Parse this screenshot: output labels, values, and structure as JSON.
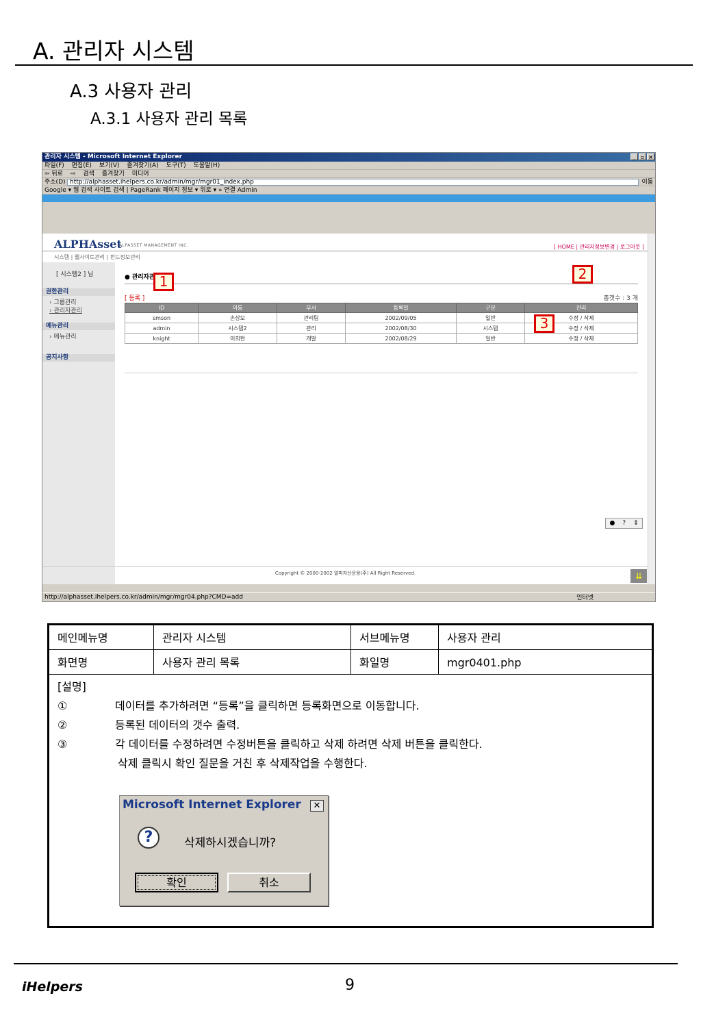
{
  "heading": {
    "h1": "A. 관리자 시스템",
    "h2": "A.3 사용자 관리",
    "h3": "A.3.1  사용자 관리 목록"
  },
  "browser": {
    "title": "관리자 시스템 - Microsoft Internet Explorer",
    "menu": [
      "파일(F)",
      "편집(E)",
      "보기(V)",
      "즐겨찾기(A)",
      "도구(T)",
      "도움말(H)"
    ],
    "toolbar": [
      "⇦ 뒤로",
      "⇨",
      "검색",
      "즐겨찾기",
      "미디어"
    ],
    "address_label": "주소(D)",
    "address": "http://alphasset.ihelpers.co.kr/admin/mgr/mgr01_index.php",
    "go_label": "이동",
    "google_bar": "Google ▾   웹 검색   사이트 검색  |  PageRank  페이지 정보 ▾  위로 ▾  »  연결   Admin",
    "status_url": "http://alphasset.ihelpers.co.kr/admin/mgr/mgr04.php?CMD=add",
    "status_zone": "인터넷"
  },
  "site": {
    "logo": "ALPHAsset",
    "logo_sub": "ALPASSET MANAGEMENT INC.",
    "top_links": "[ HOME  |  관리자정보변경  |  로그아웃 ]",
    "topnav": "시스템  |  웹사이트관리  |  펀드정보관리",
    "user": "[ 시스템2 ] 님",
    "sidebar": [
      {
        "head": "권한관리",
        "subs": [
          "› 그룹관리",
          "› 관리자관리"
        ]
      },
      {
        "head": "메뉴관리",
        "subs": [
          "› 메뉴관리"
        ]
      },
      {
        "head": "공지사항",
        "subs": []
      }
    ],
    "content_title": "● 관리자관리",
    "register": "[ 등록 ]",
    "total": "총갯수 : 3 개",
    "columns": [
      "ID",
      "이름",
      "부서",
      "등록일",
      "구분",
      "관리"
    ],
    "rows": [
      [
        "smson",
        "손상모",
        "관리팀",
        "2002/09/05",
        "일반",
        "수정 / 삭제"
      ],
      [
        "admin",
        "시스템2",
        "관리",
        "2002/08/30",
        "시스템",
        "수정 / 삭제"
      ],
      [
        "knight",
        "이희현",
        "개발",
        "2002/08/29",
        "일반",
        "수정 / 삭제"
      ]
    ],
    "copyright": "Copyright © 2000-2002 알파자산운용(주) All Right Reserved."
  },
  "callouts": [
    "1",
    "2",
    "3"
  ],
  "spec": {
    "main_menu_label": "메인메뉴명",
    "main_menu_value": "관리자 시스템",
    "sub_menu_label": "서브메뉴명",
    "sub_menu_value": "사용자 관리",
    "screen_label": "화면명",
    "screen_value": "사용자 관리 목록",
    "file_label": "화일명",
    "file_value": "mgr0401.php",
    "desc_title": "[설명]",
    "items": [
      {
        "num": "①",
        "text": "데이터를 추가하려면 “등록”을 클릭하면 등록화면으로 이동합니다."
      },
      {
        "num": "②",
        "text": "등록된 데이터의 갯수 출력."
      },
      {
        "num": "③",
        "text": "각 데이터를 수정하려면 수정버튼을 클릭하고 삭제 하려면 삭제 버튼을 클릭한다."
      }
    ],
    "extra": "삭제 클릭시 확인 질문을 거친 후 삭제작업을 수행한다."
  },
  "dialog": {
    "title": "Microsoft Internet Explorer",
    "message": "삭제하시겠습니까?",
    "ok": "확인",
    "cancel": "취소"
  },
  "footer": {
    "brand": "iHelpers",
    "page": "9"
  }
}
